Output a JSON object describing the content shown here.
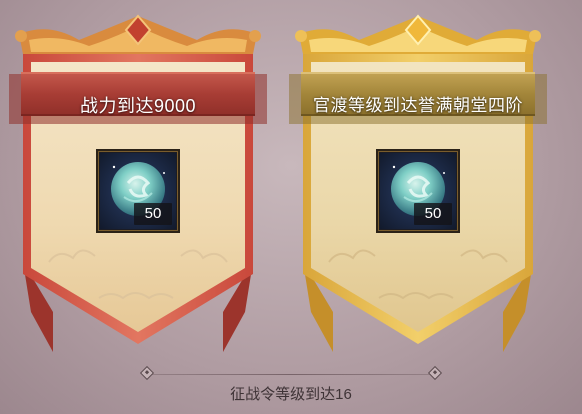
{
  "rewards": [
    {
      "variant": "red",
      "title": "战力到达9000",
      "item_icon": "swirl-orb-icon",
      "quantity": "50",
      "colors": {
        "banner": "#b0433a",
        "frame": "#d99a46",
        "parchment": "#f1dfbd"
      }
    },
    {
      "variant": "gold",
      "title": "官渡等级到达誉满朝堂四阶",
      "item_icon": "swirl-orb-icon",
      "quantity": "50",
      "colors": {
        "banner": "#a98a3c",
        "frame": "#e6c150",
        "parchment": "#ecdcb2"
      }
    }
  ],
  "footer": {
    "text": "征战令等级到达16"
  }
}
